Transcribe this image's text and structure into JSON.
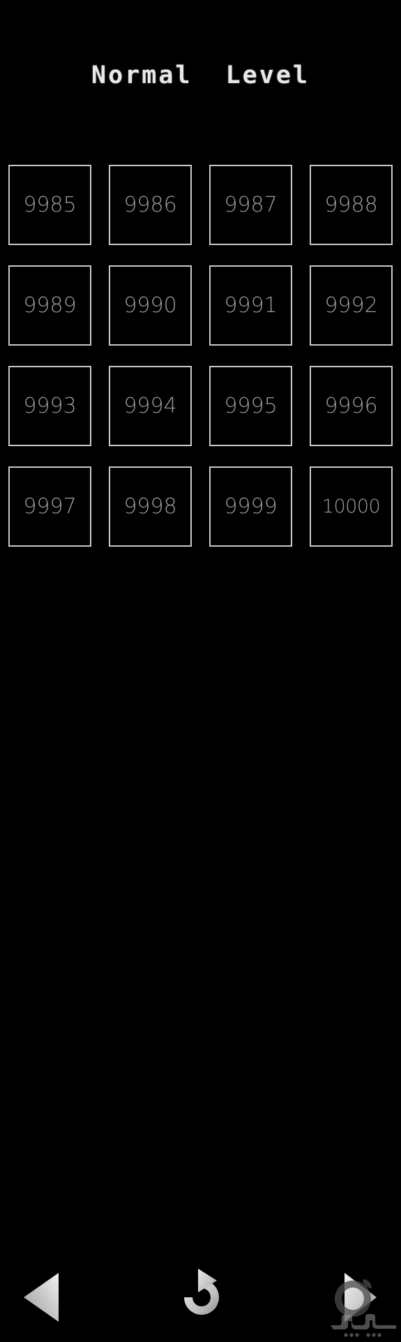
{
  "app": {
    "background_color": "#000000",
    "accent_color": "#c9c9c9",
    "text_color": "#9d9d9d"
  },
  "header": {
    "title": "Normal  Level"
  },
  "grid": {
    "columns": 4,
    "rows": 4,
    "cells": [
      {
        "label": "9985"
      },
      {
        "label": "9986"
      },
      {
        "label": "9987"
      },
      {
        "label": "9988"
      },
      {
        "label": "9989"
      },
      {
        "label": "9990"
      },
      {
        "label": "9991"
      },
      {
        "label": "9992"
      },
      {
        "label": "9993"
      },
      {
        "label": "9994"
      },
      {
        "label": "9995"
      },
      {
        "label": "9996"
      },
      {
        "label": "9997"
      },
      {
        "label": "9998"
      },
      {
        "label": "9999"
      },
      {
        "label": "10000"
      }
    ]
  },
  "bottom_nav": {
    "prev": {
      "icon": "triangle-left-icon",
      "label": ""
    },
    "reset": {
      "icon": "refresh-clockwise-icon",
      "label": ""
    },
    "next": {
      "icon": "triangle-right-icon",
      "label": ""
    }
  },
  "watermark": {
    "icon": "softgozar-logo-watermark",
    "label": ""
  }
}
